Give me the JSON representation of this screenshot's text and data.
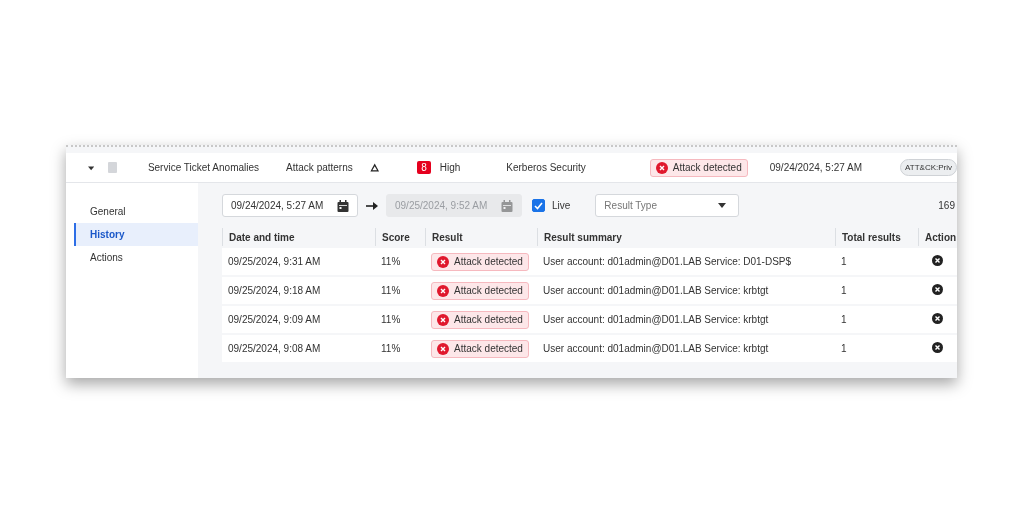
{
  "header": {
    "expanded": true,
    "checked": false,
    "name": "Service Ticket Anomalies",
    "category": "Attack patterns",
    "severity_count": "8",
    "severity": "High",
    "source": "Kerberos Security",
    "result": "Attack detected",
    "time": "09/24/2024, 5:27 AM",
    "tag": "ATT&CK:Priv"
  },
  "sidebar": {
    "items": [
      {
        "label": "General",
        "selected": false
      },
      {
        "label": "History",
        "selected": true
      },
      {
        "label": "Actions",
        "selected": false
      }
    ]
  },
  "filters": {
    "from": {
      "value": "09/24/2024, 5:27 AM",
      "disabled": false
    },
    "to": {
      "value": "09/25/2024, 9:52 AM",
      "disabled": true
    },
    "live": {
      "label": "Live",
      "checked": true
    },
    "result_type": {
      "placeholder": "Result Type"
    },
    "count": "169"
  },
  "table": {
    "columns": [
      "Date and time",
      "Score",
      "Result",
      "Result summary",
      "Total results",
      "Action"
    ],
    "rows": [
      {
        "date": "09/25/2024, 9:31 AM",
        "score": "11%",
        "result": "Attack detected",
        "summary": "User account: d01admin@D01.LAB Service: D01-DSP$",
        "total": "1"
      },
      {
        "date": "09/25/2024, 9:18 AM",
        "score": "11%",
        "result": "Attack detected",
        "summary": "User account: d01admin@D01.LAB Service: krbtgt",
        "total": "1"
      },
      {
        "date": "09/25/2024, 9:09 AM",
        "score": "11%",
        "result": "Attack detected",
        "summary": "User account: d01admin@D01.LAB Service: krbtgt",
        "total": "1"
      },
      {
        "date": "09/25/2024, 9:08 AM",
        "score": "11%",
        "result": "Attack detected",
        "summary": "User account: d01admin@D01.LAB Service: krbtgt",
        "total": "1"
      }
    ]
  }
}
